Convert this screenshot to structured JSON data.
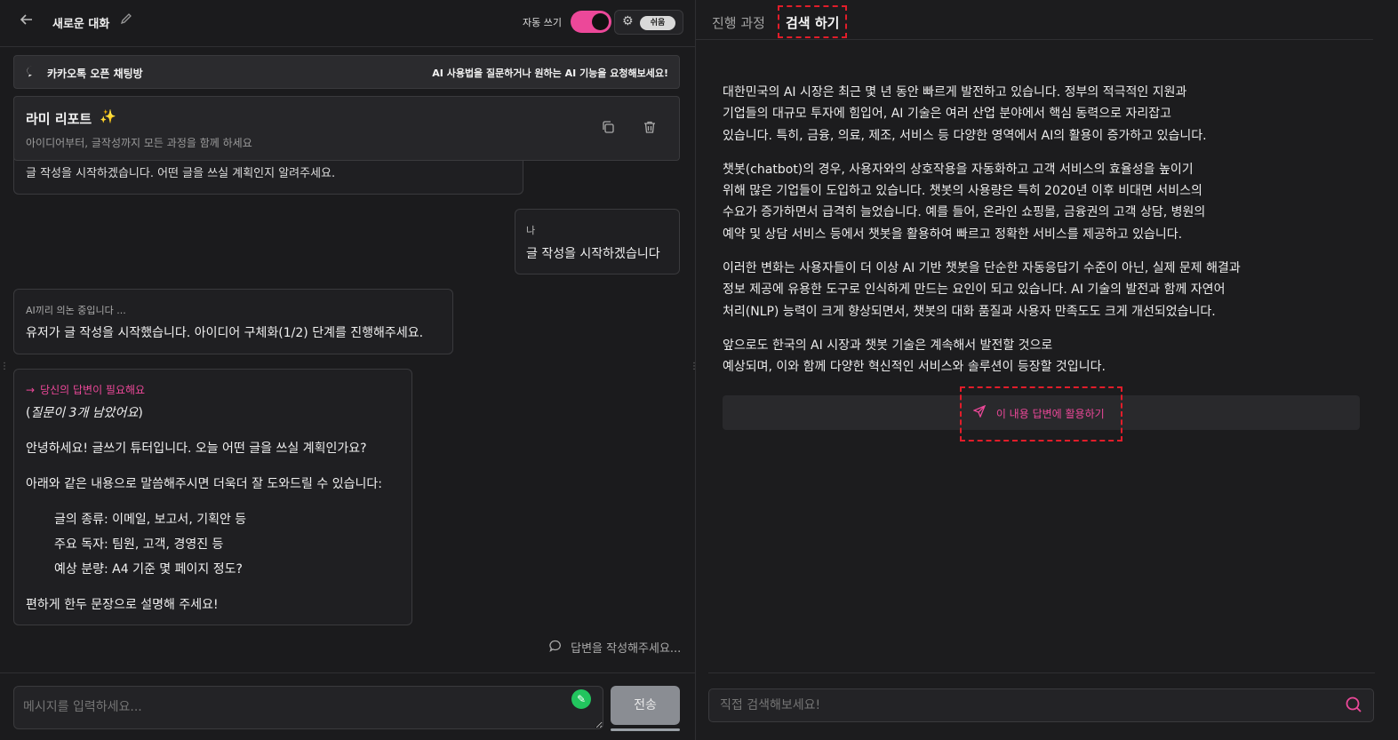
{
  "header": {
    "title": "새로운 대화",
    "auto_write_label": "자동 쓰기",
    "mode_label": "쉬움"
  },
  "banner": {
    "name": "카카오톡 오픈 채팅방",
    "hint": "AI 사용법을 질문하거나 원하는 AI 기능을 요청해보세요!"
  },
  "report": {
    "title": "라미 리포트",
    "star": "✨",
    "subtitle": "아이디어부터, 글작성까지 모든 과정을 함께 하세요"
  },
  "chat": {
    "clipped_text": "글 작성을 시작하겠습니다. 어떤 글을 쓰실 계획인지 알려주세요.",
    "me_label": "나",
    "me_text": "글 작성을 시작하겠습니다",
    "ai1_label": "AI끼리 의논 중입니다 ...",
    "ai1_text": "유저가 글 작성을 시작했습니다. 아이디어 구체화(1/2) 단계를 진행해주세요.",
    "need_label": "당신의 답변이 필요해요",
    "remain_open": "(",
    "remain_text": "질문이 3개 남았어요",
    "remain_close": ")",
    "greet": "안녕하세요! 글쓰기 튜터입니다. 오늘 어떤 글을 쓰실 계획인가요?",
    "guide": "아래와 같은 내용으로 말씀해주시면 더욱더 잘 도와드릴 수 있습니다:",
    "items": [
      "글의 종류: 이메일, 보고서, 기획안 등",
      "주요 독자: 팀원, 고객, 경영진 등",
      "예상 분량: A4 기준 몇 페이지 정도?"
    ],
    "closing": "편하게 한두 문장으로 설명해 주세요!",
    "typing": "답변을 작성해주세요..."
  },
  "composer": {
    "placeholder": "메시지를 입력하세요...",
    "send_label": "전송"
  },
  "right": {
    "tab_progress": "진행 과정",
    "tab_search": "검색 하기",
    "paragraphs": [
      "대한민국의 AI 시장은 최근 몇 년 동안 빠르게 발전하고 있습니다. 정부의 적극적인 지원과\n기업들의 대규모 투자에 힘입어, AI 기술은 여러 산업 분야에서 핵심 동력으로 자리잡고\n있습니다. 특히, 금융, 의료, 제조, 서비스 등 다양한 영역에서 AI의 활용이 증가하고 있습니다.",
      "챗봇(chatbot)의 경우, 사용자와의 상호작용을 자동화하고 고객 서비스의 효율성을 높이기\n위해 많은 기업들이 도입하고 있습니다. 챗봇의 사용량은 특히 2020년 이후 비대면 서비스의\n수요가 증가하면서 급격히 늘었습니다. 예를 들어, 온라인 쇼핑몰, 금융권의 고객 상담, 병원의\n예약 및 상담 서비스 등에서 챗봇을 활용하여 빠르고 정확한 서비스를 제공하고 있습니다.",
      "이러한 변화는 사용자들이 더 이상 AI 기반 챗봇을 단순한 자동응답기 수준이 아닌, 실제 문제 해결과\n정보 제공에 유용한 도구로 인식하게 만드는 요인이 되고 있습니다. AI 기술의 발전과 함께 자연어\n처리(NLP) 능력이 크게 향상되면서, 챗봇의 대화 품질과 사용자 만족도도 크게 개선되었습니다.",
      "앞으로도 한국의 AI 시장과 챗봇 기술은 계속해서 발전할 것으로\n예상되며, 이와 함께 다양한 혁신적인 서비스와 솔루션이 등장할 것입니다."
    ],
    "use_button": "이 내용 답변에 활용하기",
    "search_placeholder": "직접 검색해보세요!"
  },
  "colors": {
    "accent": "#ec4899",
    "highlight": "#e11d2a",
    "pen_badge": "#22c55e"
  }
}
